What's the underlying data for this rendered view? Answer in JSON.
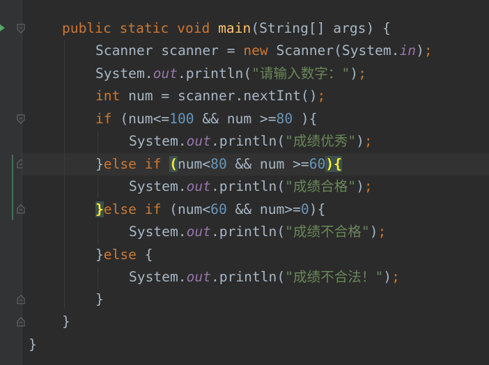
{
  "editor": {
    "theme": {
      "background": "#2b2b2b",
      "gutter": "#313335",
      "keyword": "#cc7832",
      "function": "#ffc66d",
      "number": "#6897bb",
      "string": "#6a8759",
      "field": "#9876aa",
      "plain": "#a9b7c6",
      "brace_match": "#ffef28",
      "brace_match_bg": "#3b514d"
    },
    "highlighted_line": 7,
    "lines": [
      {
        "t": "public"
      },
      {
        "t": "static"
      },
      {
        "t": "void"
      },
      {
        "t": "main"
      },
      {
        "t": "(String[] args) {"
      },
      {
        "t": "Scanner scanner = "
      },
      {
        "t": "new"
      },
      {
        "t": " Scanner(System."
      },
      {
        "t": "in"
      },
      {
        "t": ")"
      },
      {
        "t": ";"
      },
      {
        "t": "System."
      },
      {
        "t": "out"
      },
      {
        "t": ".println("
      },
      {
        "t": "\"请输入数字：\""
      },
      {
        "t": ")"
      },
      {
        "t": ";"
      },
      {
        "t": "int"
      },
      {
        "t": " num = scanner.nextInt()"
      },
      {
        "t": ";"
      },
      {
        "t": "if"
      },
      {
        "t": " (num<="
      },
      {
        "t": "100"
      },
      {
        "t": " && num >="
      },
      {
        "t": "80"
      },
      {
        "t": " ){"
      },
      {
        "t": "System."
      },
      {
        "t": "out"
      },
      {
        "t": ".println("
      },
      {
        "t": "\"成绩优秀\""
      },
      {
        "t": ")"
      },
      {
        "t": ";"
      },
      {
        "t": "}"
      },
      {
        "t": "else if"
      },
      {
        "t": " "
      },
      {
        "t": "("
      },
      {
        "t": "num<"
      },
      {
        "t": "80"
      },
      {
        "t": " && num >="
      },
      {
        "t": "60"
      },
      {
        "t": ")"
      },
      {
        "t": "{"
      },
      {
        "t": "System."
      },
      {
        "t": "out"
      },
      {
        "t": ".println("
      },
      {
        "t": "\"成绩合格\""
      },
      {
        "t": ")"
      },
      {
        "t": ";"
      },
      {
        "t": "}"
      },
      {
        "t": "else if"
      },
      {
        "t": " (num<"
      },
      {
        "t": "60"
      },
      {
        "t": " && num>="
      },
      {
        "t": "0"
      },
      {
        "t": "){"
      },
      {
        "t": "System."
      },
      {
        "t": "out"
      },
      {
        "t": ".println("
      },
      {
        "t": "\"成绩不合格\""
      },
      {
        "t": ")"
      },
      {
        "t": ";"
      },
      {
        "t": "}"
      },
      {
        "t": "else"
      },
      {
        "t": " {"
      },
      {
        "t": "System."
      },
      {
        "t": "out"
      },
      {
        "t": ".println("
      },
      {
        "t": "\"成绩不合法！\""
      },
      {
        "t": ")"
      },
      {
        "t": ";"
      },
      {
        "t": "}"
      },
      {
        "t": "}"
      },
      {
        "t": "}"
      }
    ]
  }
}
